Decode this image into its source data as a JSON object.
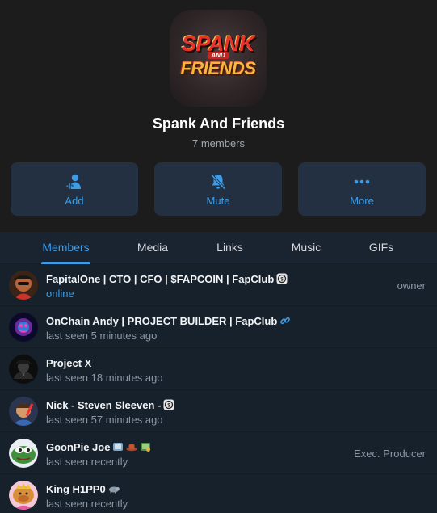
{
  "group": {
    "logo_line1": "SPANK",
    "logo_and": "AND",
    "logo_line2": "FRIENDS",
    "title": "Spank And Friends",
    "member_count": "7 members"
  },
  "actions": [
    {
      "label": "Add",
      "icon": "add-user-icon"
    },
    {
      "label": "Mute",
      "icon": "bell-muted-icon"
    },
    {
      "label": "More",
      "icon": "more-dots-icon"
    }
  ],
  "tabs": [
    {
      "label": "Members",
      "active": true
    },
    {
      "label": "Media"
    },
    {
      "label": "Links"
    },
    {
      "label": "Music"
    },
    {
      "label": "GIFs"
    }
  ],
  "members": [
    {
      "name": "FapitalOne | CTO | CFO | $FAPCOIN | FapClub",
      "status": "online",
      "role": "owner"
    },
    {
      "name": "OnChain Andy | PROJECT BUILDER | FapClub",
      "status": "last seen 5 minutes ago",
      "role": ""
    },
    {
      "name": "Project X",
      "status": "last seen 18 minutes ago",
      "role": ""
    },
    {
      "name": "Nick - Steven Sleeven -",
      "status": "last seen 57 minutes ago",
      "role": ""
    },
    {
      "name": "GoonPie Joe",
      "status": "last seen recently",
      "role": "Exec. Producer"
    },
    {
      "name": "King H1PP0",
      "status": "last seen recently",
      "role": ""
    }
  ],
  "colors": {
    "accent": "#3d9ce5",
    "header_bg": "#1c1c1d",
    "list_bg": "#17212b",
    "button_bg": "#223042"
  }
}
